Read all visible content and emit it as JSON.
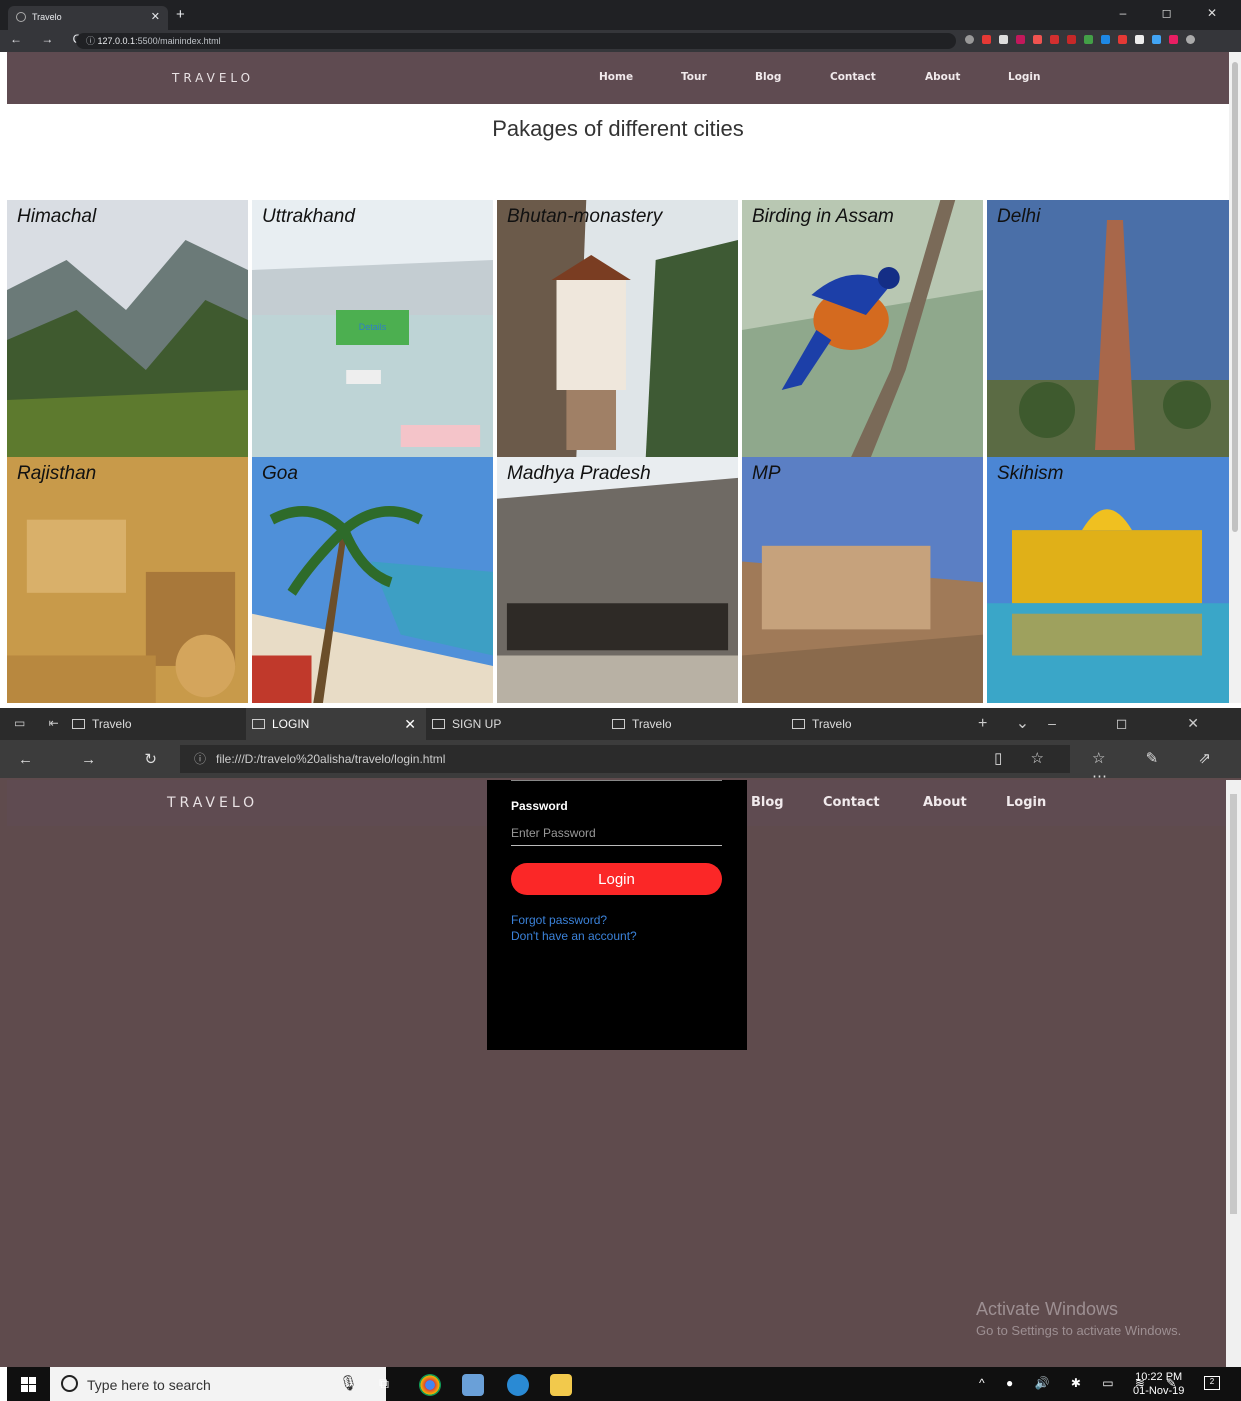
{
  "chrome": {
    "tab_title": "Travelo",
    "new_tab": "+",
    "window_controls": "– ◻ ✕",
    "nav": "← → C",
    "url_host": "127.0.0.1",
    "url_path": ":5500/mainindex.html"
  },
  "site": {
    "logo": "TRAVELO",
    "nav": [
      "Home",
      "Tour",
      "Blog",
      "Contact",
      "About",
      "Login"
    ],
    "packages_title": "Pakages of different cities",
    "details_button": "Details",
    "cities": [
      "Himachal",
      "Uttrakhand",
      "Bhutan-monastery",
      "Birding in Assam",
      "Delhi",
      "Rajisthan",
      "Goa",
      "Madhya Pradesh",
      "MP",
      "Skihism"
    ]
  },
  "edge": {
    "tabs": [
      {
        "label": "Travelo",
        "active": false
      },
      {
        "label": "LOGIN",
        "active": true
      },
      {
        "label": "SIGN UP",
        "active": false
      },
      {
        "label": "Travelo",
        "active": false
      },
      {
        "label": "Travelo",
        "active": false
      }
    ],
    "address": "file:///D:/travelo%20alisha/travelo/login.html",
    "login": {
      "password_label": "Password",
      "password_placeholder": "Enter Password",
      "login_button": "Login",
      "forgot": "Forgot password?",
      "no_account": "Don't have an account?"
    },
    "nav_visible": [
      "Blog",
      "Contact",
      "About",
      "Login"
    ],
    "watermark_title": "Activate Windows",
    "watermark_sub": "Go to Settings to activate Windows."
  },
  "taskbar": {
    "search_placeholder": "Type here to search",
    "time": "10:22 PM",
    "date": "01-Nov-19",
    "notifications": "2"
  },
  "colors": {
    "nav_bg": "#5f4b51",
    "login_button": "#fb2727",
    "details_button": "#4caf50"
  }
}
